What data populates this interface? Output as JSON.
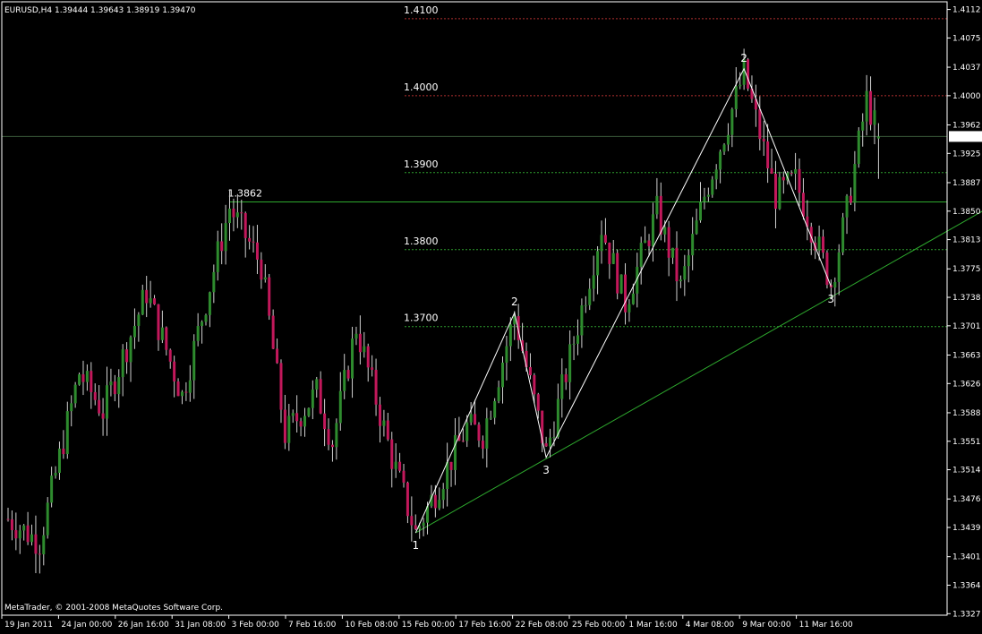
{
  "window": {
    "title": "EURUSD,H4  1.39444 1.39643 1.38919 1.39470",
    "copyright": "MetaTrader, © 2001-2008 MetaQuotes Software Corp."
  },
  "colors": {
    "background": "#000000",
    "frame": "#ffffff",
    "bull": "#2e8b2e",
    "bear": "#c2185b",
    "wick": "#d0d0d0",
    "level_red": "#b03030",
    "level_green": "#2e9e2e",
    "trendline": "#2eaa2e",
    "wave": "#ffffff",
    "price_tag_bg": "#ffffff",
    "price_tag_text": "#000000"
  },
  "chart_data": {
    "type": "candlestick",
    "symbol": "EURUSD",
    "timeframe": "H4",
    "last_quote": {
      "open": 1.39444,
      "high": 1.39643,
      "low": 1.38919,
      "close": 1.3947
    },
    "current_price": "1.3947",
    "y_range": [
      1.3325,
      1.4122
    ],
    "y_ticks": [
      "1.4112",
      "1.4075",
      "1.4037",
      "1.4000",
      "1.3962",
      "1.3925",
      "1.3887",
      "1.3850",
      "1.3813",
      "1.3775",
      "1.3738",
      "1.3701",
      "1.3663",
      "1.3626",
      "1.3588",
      "1.3551",
      "1.3514",
      "1.3476",
      "1.3439",
      "1.3401",
      "1.3364",
      "1.3327"
    ],
    "x_ticks": [
      "19 Jan 2011",
      "24 Jan 00:00",
      "26 Jan 16:00",
      "31 Jan 08:00",
      "3 Feb 00:00",
      "7 Feb 16:00",
      "10 Feb 08:00",
      "15 Feb 00:00",
      "17 Feb 16:00",
      "22 Feb 08:00",
      "25 Feb 00:00",
      "1 Mar 16:00",
      "4 Mar 08:00",
      "9 Mar 00:00",
      "11 Mar 16:00"
    ],
    "bars_total": 221,
    "levels": [
      {
        "label": "1.4100",
        "price": 1.41,
        "style": "red"
      },
      {
        "label": "1.4000",
        "price": 1.4,
        "style": "red"
      },
      {
        "label": "1.3900",
        "price": 1.39,
        "style": "green"
      },
      {
        "label": "1.3800",
        "price": 1.38,
        "style": "green"
      },
      {
        "label": "1.3700",
        "price": 1.37,
        "style": "green"
      }
    ],
    "resistance": {
      "label": "1.3862",
      "price": 1.3862,
      "start_bar": 56
    },
    "trendline": [
      {
        "bar": 103,
        "price": 1.3432
      },
      {
        "bar": 249,
        "price": 1.3858
      }
    ],
    "waves": [
      {
        "points": [
          {
            "bar": 103,
            "price": 1.3432,
            "label": "1"
          },
          {
            "bar": 128,
            "price": 1.3718,
            "label": "2"
          },
          {
            "bar": 136,
            "price": 1.353,
            "label": "3"
          },
          {
            "bar": 186,
            "price": 1.4035,
            "label": "2"
          },
          {
            "bar": 208,
            "price": 1.3752,
            "label": "3"
          }
        ]
      }
    ],
    "pivots": [
      {
        "bar": 0,
        "price": 1.345
      },
      {
        "bar": 8,
        "price": 1.342
      },
      {
        "bar": 18,
        "price": 1.364
      },
      {
        "bar": 24,
        "price": 1.359
      },
      {
        "bar": 35,
        "price": 1.3745
      },
      {
        "bar": 44,
        "price": 1.361
      },
      {
        "bar": 56,
        "price": 1.3855
      },
      {
        "bar": 64,
        "price": 1.378
      },
      {
        "bar": 70,
        "price": 1.356
      },
      {
        "bar": 78,
        "price": 1.3615
      },
      {
        "bar": 82,
        "price": 1.355
      },
      {
        "bar": 88,
        "price": 1.37
      },
      {
        "bar": 97,
        "price": 1.353
      },
      {
        "bar": 103,
        "price": 1.3432
      },
      {
        "bar": 116,
        "price": 1.357
      },
      {
        "bar": 120,
        "price": 1.356
      },
      {
        "bar": 128,
        "price": 1.3715
      },
      {
        "bar": 136,
        "price": 1.3535
      },
      {
        "bar": 142,
        "price": 1.366
      },
      {
        "bar": 150,
        "price": 1.383
      },
      {
        "bar": 156,
        "price": 1.373
      },
      {
        "bar": 164,
        "price": 1.385
      },
      {
        "bar": 170,
        "price": 1.375
      },
      {
        "bar": 176,
        "price": 1.387
      },
      {
        "bar": 186,
        "price": 1.403
      },
      {
        "bar": 194,
        "price": 1.387
      },
      {
        "bar": 199,
        "price": 1.389
      },
      {
        "bar": 208,
        "price": 1.3755
      },
      {
        "bar": 212,
        "price": 1.385
      },
      {
        "bar": 217,
        "price": 1.3995
      },
      {
        "bar": 220,
        "price": 1.3947
      }
    ]
  }
}
